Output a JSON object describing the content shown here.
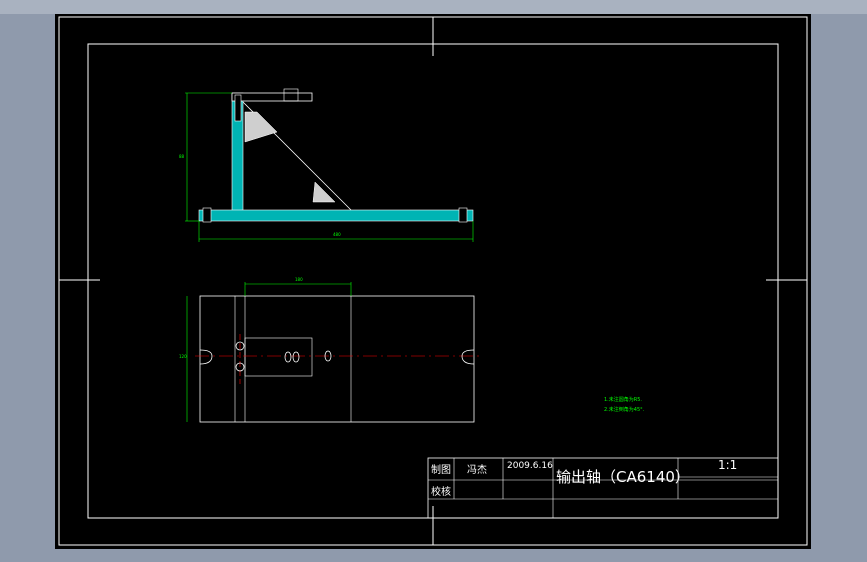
{
  "colors": {
    "background": "#8f9aac",
    "sheet": "#000000",
    "outline": "#ffffff",
    "dimension": "#00ff00",
    "centerline": "#ff0000",
    "section": "#00c8c8",
    "hatch": "#cccccc"
  },
  "title_block": {
    "row1_label": "制图",
    "row1_name": "冯杰",
    "date": "2009.6.16",
    "title": "输出轴（CA6140）",
    "scale": "1:1",
    "row2_label": "校核"
  },
  "notes": {
    "line1": "1.未注圆角为R5.",
    "line2": "2.未注倒角为45°."
  },
  "dimensions": {
    "height_front": "88",
    "width_front": "480",
    "height_top": "120",
    "width_top": "180"
  }
}
